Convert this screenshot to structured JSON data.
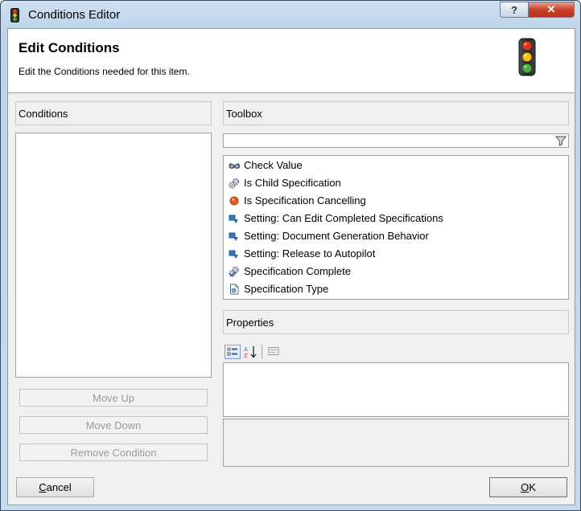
{
  "window": {
    "title": "Conditions Editor",
    "help_glyph": "?",
    "close_glyph": "✕"
  },
  "header": {
    "title": "Edit Conditions",
    "subtitle": "Edit the Conditions needed for this item."
  },
  "conditions": {
    "heading": "Conditions",
    "items": []
  },
  "buttons": {
    "move_up": "Move Up",
    "move_down": "Move Down",
    "remove_condition": "Remove Condition",
    "cancel_first": "C",
    "cancel_rest": "ancel",
    "ok_first": "O",
    "ok_rest": "K"
  },
  "toolbox": {
    "heading": "Toolbox",
    "filter_value": "",
    "items": [
      {
        "label": "Check Value",
        "icon": "glasses-icon"
      },
      {
        "label": "Is Child Specification",
        "icon": "gears-icon"
      },
      {
        "label": "Is Specification Cancelling",
        "icon": "red-dot-icon"
      },
      {
        "label": "Setting: Can Edit Completed Specifications",
        "icon": "setting-icon"
      },
      {
        "label": "Setting: Document Generation Behavior",
        "icon": "setting-icon"
      },
      {
        "label": "Setting: Release to Autopilot",
        "icon": "setting-icon"
      },
      {
        "label": "Specification Complete",
        "icon": "gears-check-icon"
      },
      {
        "label": "Specification Type",
        "icon": "document-icon"
      }
    ]
  },
  "properties": {
    "heading": "Properties",
    "toolbar": [
      "categorized-icon",
      "alphabetical-sort-icon",
      "property-pages-icon"
    ]
  },
  "colors": {
    "title_bar": "#c7dbef",
    "close_button": "#c7402a",
    "cancelling_dot": "#e85a1c"
  }
}
